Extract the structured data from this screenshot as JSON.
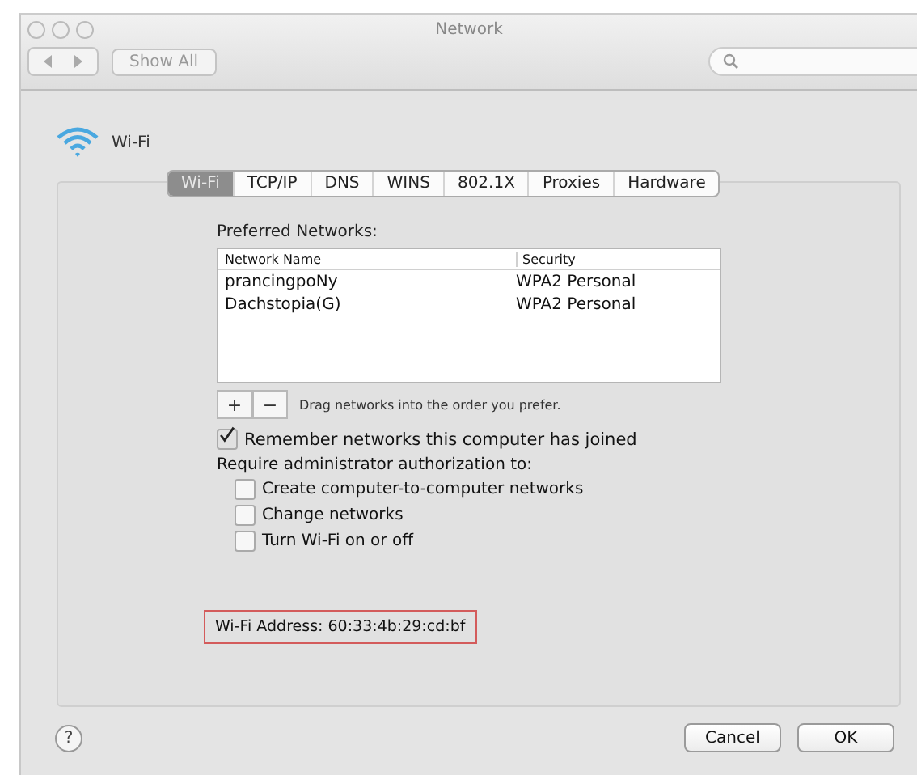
{
  "window": {
    "title": "Network"
  },
  "toolbar": {
    "show_all": "Show All"
  },
  "service": {
    "name": "Wi-Fi"
  },
  "tabs": [
    {
      "label": "Wi-Fi",
      "selected": true
    },
    {
      "label": "TCP/IP",
      "selected": false
    },
    {
      "label": "DNS",
      "selected": false
    },
    {
      "label": "WINS",
      "selected": false
    },
    {
      "label": "802.1X",
      "selected": false
    },
    {
      "label": "Proxies",
      "selected": false
    },
    {
      "label": "Hardware",
      "selected": false
    }
  ],
  "preferred_networks": {
    "label": "Preferred Networks:",
    "columns": [
      "Network Name",
      "Security"
    ],
    "rows": [
      [
        "prancingpoNy",
        "WPA2 Personal"
      ],
      [
        "Dachstopia(G)",
        "WPA2 Personal"
      ]
    ],
    "add": "+",
    "remove": "−",
    "hint": "Drag networks into the order you prefer."
  },
  "remember": {
    "label": "Remember networks this computer has joined",
    "checked": true
  },
  "require": {
    "label": "Require administrator authorization to:",
    "options": [
      {
        "label": "Create computer-to-computer networks",
        "checked": false
      },
      {
        "label": "Change networks",
        "checked": false
      },
      {
        "label": "Turn Wi-Fi on or off",
        "checked": false
      }
    ]
  },
  "address": {
    "text": "Wi-Fi Address: 60:33:4b:29:cd:bf",
    "highlighted": true
  },
  "help": "?",
  "buttons": [
    "Cancel",
    "OK"
  ]
}
